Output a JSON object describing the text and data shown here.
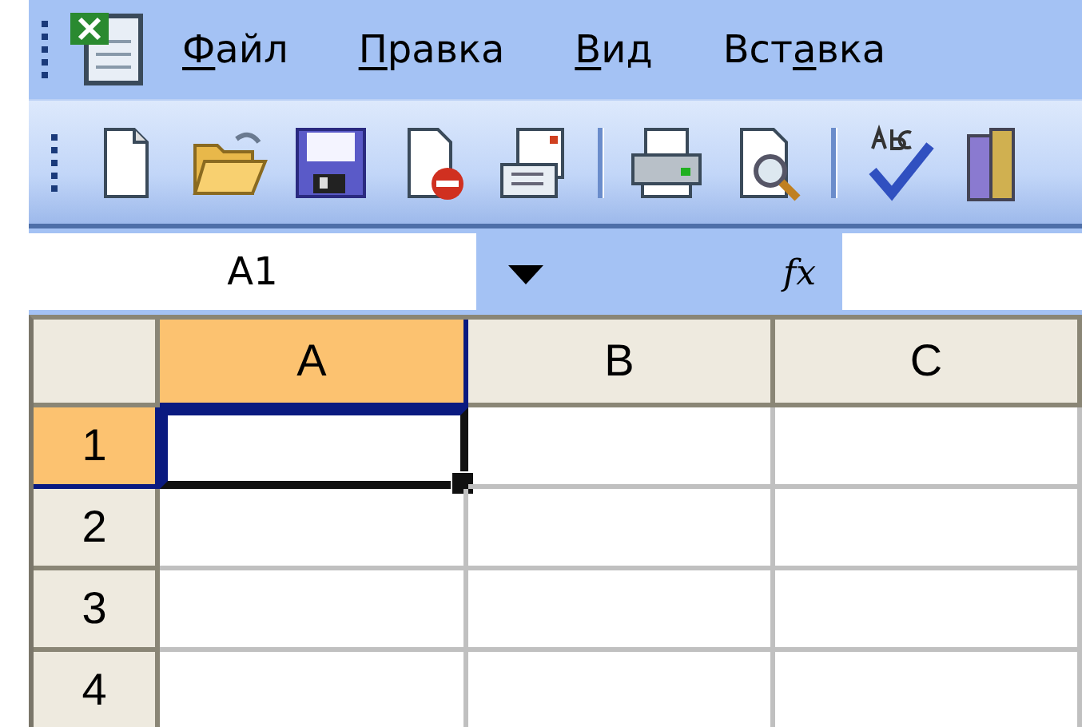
{
  "menu": [
    {
      "key": "Ф",
      "after": "айл"
    },
    {
      "key": "П",
      "after": "равка"
    },
    {
      "key": "В",
      "after": "ид"
    },
    {
      "before": "Вст",
      "key": "а",
      "after": "вка"
    }
  ],
  "formula_bar": {
    "name_box": "A1",
    "function_label": "fx"
  },
  "sheet": {
    "columns": [
      {
        "label": "A",
        "selected": true
      },
      {
        "label": "B",
        "selected": false
      },
      {
        "label": "C",
        "selected": false
      }
    ],
    "rows": [
      {
        "label": "1",
        "selected": true,
        "cells": [
          {
            "selected": true
          },
          {
            "selected": false
          },
          {
            "selected": false
          }
        ]
      },
      {
        "label": "2",
        "selected": false,
        "cells": [
          {
            "selected": false
          },
          {
            "selected": false
          },
          {
            "selected": false
          }
        ]
      },
      {
        "label": "3",
        "selected": false,
        "cells": [
          {
            "selected": false
          },
          {
            "selected": false
          },
          {
            "selected": false
          }
        ]
      },
      {
        "label": "4",
        "selected": false,
        "cells": [
          {
            "selected": false
          },
          {
            "selected": false
          },
          {
            "selected": false
          }
        ]
      }
    ]
  }
}
